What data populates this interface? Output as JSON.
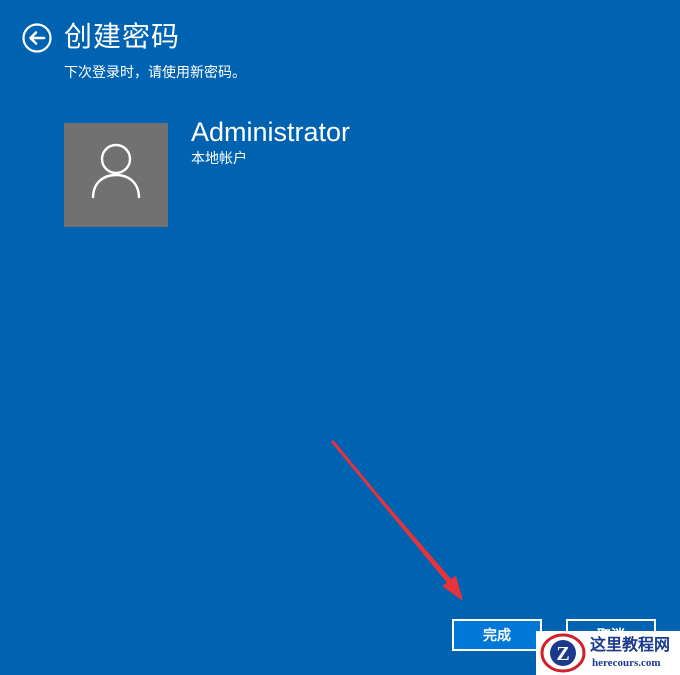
{
  "header": {
    "back_icon": "back-arrow-icon",
    "title": "创建密码",
    "subtitle": "下次登录时，请使用新密码。"
  },
  "account": {
    "avatar_icon": "user-icon",
    "name": "Administrator",
    "type": "本地帐户"
  },
  "buttons": {
    "finish_label": "完成",
    "cancel_label": "取消"
  },
  "watermark": {
    "logo_letter": "Z",
    "site_name": "这里教程网",
    "url": "herecours.com"
  },
  "colors": {
    "background": "#0063b1",
    "avatar": "#717171",
    "primary_button": "#0078d7",
    "annotation_arrow": "#e8333a"
  }
}
